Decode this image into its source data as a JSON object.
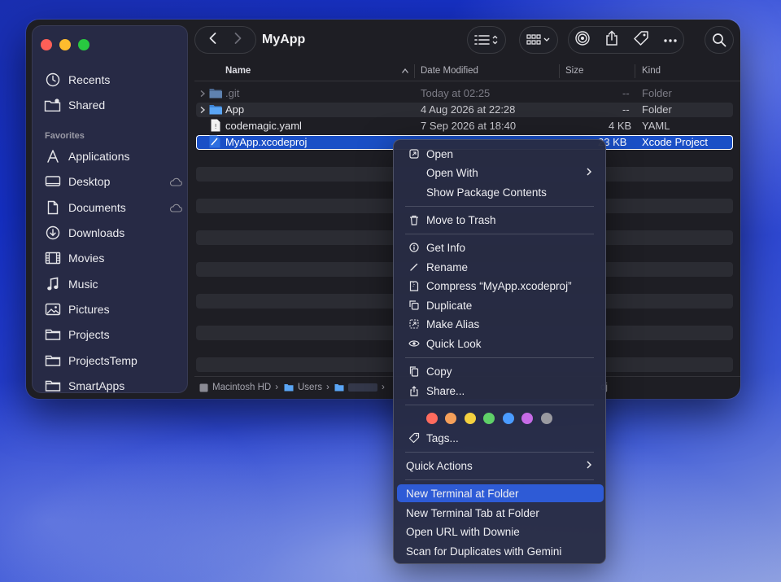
{
  "window": {
    "title": "MyApp"
  },
  "sidebar": {
    "top": [
      {
        "label": "Recents",
        "icon": "clock-icon"
      },
      {
        "label": "Shared",
        "icon": "shared-folder-icon"
      }
    ],
    "favorites_label": "Favorites",
    "favorites": [
      {
        "label": "Applications",
        "icon": "applications-icon"
      },
      {
        "label": "Desktop",
        "icon": "desktop-icon"
      },
      {
        "label": "Documents",
        "icon": "document-icon"
      },
      {
        "label": "Downloads",
        "icon": "download-icon"
      },
      {
        "label": "Movies",
        "icon": "film-icon"
      },
      {
        "label": "Music",
        "icon": "music-note-icon"
      },
      {
        "label": "Pictures",
        "icon": "photo-icon"
      },
      {
        "label": "Projects",
        "icon": "folder-icon"
      },
      {
        "label": "ProjectsTemp",
        "icon": "folder-icon"
      },
      {
        "label": "SmartApps",
        "icon": "folder-icon"
      }
    ]
  },
  "columns": {
    "name": "Name",
    "date": "Date Modified",
    "size": "Size",
    "kind": "Kind"
  },
  "files": [
    {
      "name": ".git",
      "date": "Today at 02:25",
      "size": "--",
      "kind": "Folder"
    },
    {
      "name": "App",
      "date": "4 Aug 2026 at 22:28",
      "size": "--",
      "kind": "Folder"
    },
    {
      "name": "codemagic.yaml",
      "date": "7 Sep 2026 at 18:40",
      "size": "4 KB",
      "kind": "YAML"
    },
    {
      "name": "MyApp.xcodeproj",
      "date": "",
      "size": "23 KB",
      "kind": "Xcode Project"
    }
  ],
  "pathbar": {
    "disk": "Macintosh HD",
    "users": "Users",
    "file_tail": "oj"
  },
  "context_menu": {
    "open": "Open",
    "open_with": "Open With",
    "show_package": "Show Package Contents",
    "move_trash": "Move to Trash",
    "get_info": "Get Info",
    "rename": "Rename",
    "compress": "Compress “MyApp.xcodeproj”",
    "duplicate": "Duplicate",
    "make_alias": "Make Alias",
    "quick_look": "Quick Look",
    "copy": "Copy",
    "share": "Share...",
    "tags": "Tags...",
    "quick_actions": "Quick Actions",
    "new_terminal": "New Terminal at Folder",
    "new_terminal_tab": "New Terminal Tab at Folder",
    "open_url": "Open URL with Downie",
    "scan_duplicates": "Scan for Duplicates with Gemini"
  },
  "tag_colors": [
    "#ff6b5e",
    "#f5a05a",
    "#f4d03f",
    "#5fd068",
    "#4a9bff",
    "#c66be6",
    "#9a9aa0"
  ]
}
